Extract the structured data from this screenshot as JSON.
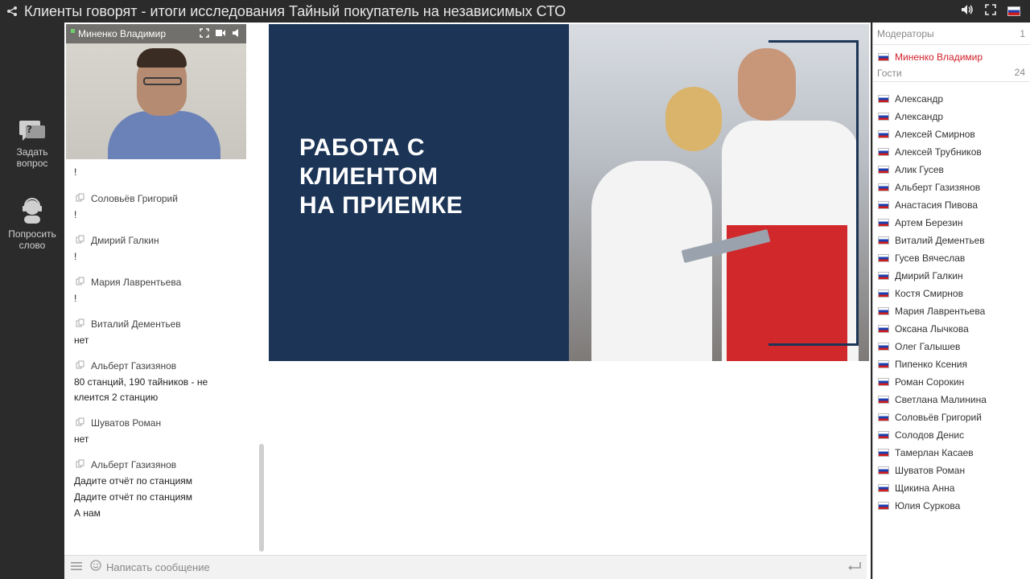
{
  "window": {
    "title": "Клиенты говорят - итоги исследования Тайный покупатель на независимых СТО"
  },
  "left_toolbar": {
    "ask": "Задать\nвопрос",
    "ask_line1": "Задать",
    "ask_line2": "вопрос",
    "speak_line1": "Попросить",
    "speak_line2": "слово"
  },
  "video": {
    "name": "Миненко Владимир"
  },
  "chat": {
    "leading_text": "!",
    "messages": [
      {
        "author": "Соловьёв Григорий",
        "lines": [
          "!"
        ]
      },
      {
        "author": "Дмирий Галкин",
        "lines": [
          "!"
        ]
      },
      {
        "author": "Мария Лаврентьева",
        "lines": [
          "!"
        ]
      },
      {
        "author": "Виталий Дементьев",
        "lines": [
          "нет"
        ]
      },
      {
        "author": "Альберт Газизянов",
        "lines": [
          "80 станций, 190 тайников - не клеится 2 станцию"
        ]
      },
      {
        "author": "Шуватов Роман",
        "lines": [
          "нет"
        ]
      },
      {
        "author": "Альберт Газизянов",
        "lines": [
          "Дадите отчёт по станциям",
          "Дадите отчёт по станциям",
          "А нам"
        ]
      }
    ],
    "input_placeholder": "Написать сообщение"
  },
  "slide": {
    "line1": "РАБОТА С",
    "line2": "КЛИЕНТОМ",
    "line3": "НА ПРИЕМКЕ"
  },
  "participants": {
    "moderators_label": "Модераторы",
    "moderators_count": "1",
    "moderators": [
      "Миненко Владимир"
    ],
    "guests_label": "Гости",
    "guests_count": "24",
    "guests": [
      "Александр",
      "Александр",
      "Алексей Смирнов",
      "Алексей Трубников",
      "Алик Гусев",
      "Альберт Газизянов",
      "Анастасия Пивова",
      "Артем Березин",
      "Виталий Дементьев",
      "Гусев Вячеслав",
      "Дмирий Галкин",
      "Костя Смирнов",
      "Мария Лаврентьева",
      "Оксана Лычкова",
      "Олег Галышев",
      "Пипенко Ксения",
      "Роман Сорокин",
      "Светлана Малинина",
      "Соловьёв Григорий",
      "Солодов Денис",
      "Тамерлан Касаев",
      "Шуватов Роман",
      "Щикина Анна",
      "Юлия Суркова"
    ]
  },
  "colors": {
    "slide_bg": "#1c3557",
    "moderator_text": "#d0202a",
    "chrome": "#2b2b2b"
  }
}
